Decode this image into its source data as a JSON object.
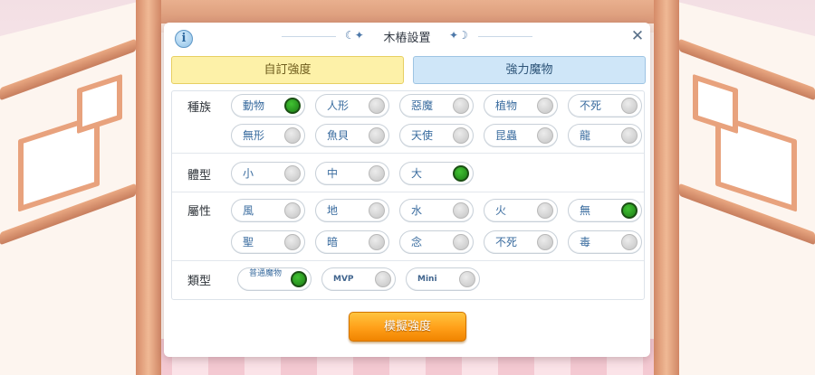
{
  "dialog": {
    "title": "木樁設置",
    "info_icon": "info-icon",
    "close_icon": "close-icon",
    "tabs": [
      {
        "label": "自訂強度",
        "active": true
      },
      {
        "label": "強力魔物",
        "active": false
      }
    ],
    "sections": {
      "race": {
        "label": "種族",
        "options": [
          {
            "label": "動物",
            "on": true
          },
          {
            "label": "人形",
            "on": false
          },
          {
            "label": "惡魔",
            "on": false
          },
          {
            "label": "植物",
            "on": false
          },
          {
            "label": "不死",
            "on": false
          },
          {
            "label": "無形",
            "on": false
          },
          {
            "label": "魚貝",
            "on": false
          },
          {
            "label": "天使",
            "on": false
          },
          {
            "label": "昆蟲",
            "on": false
          },
          {
            "label": "龍",
            "on": false
          }
        ]
      },
      "size": {
        "label": "體型",
        "options": [
          {
            "label": "小",
            "on": false
          },
          {
            "label": "中",
            "on": false
          },
          {
            "label": "大",
            "on": true
          }
        ]
      },
      "element": {
        "label": "屬性",
        "options": [
          {
            "label": "風",
            "on": false
          },
          {
            "label": "地",
            "on": false
          },
          {
            "label": "水",
            "on": false
          },
          {
            "label": "火",
            "on": false
          },
          {
            "label": "無",
            "on": true
          },
          {
            "label": "聖",
            "on": false
          },
          {
            "label": "暗",
            "on": false
          },
          {
            "label": "念",
            "on": false
          },
          {
            "label": "不死",
            "on": false
          },
          {
            "label": "毒",
            "on": false
          }
        ]
      },
      "type": {
        "label": "類型",
        "options": [
          {
            "label": "普通魔物",
            "on": true
          },
          {
            "label": "MVP",
            "on": false
          },
          {
            "label": "Mini",
            "on": false
          }
        ]
      }
    },
    "simulate_label": "模擬強度"
  },
  "colors": {
    "toggle_on": "#2a9d20",
    "toggle_off": "#cfcfcf",
    "accent_orange": "#ff9f18",
    "tab_yellow": "#fdf1a8",
    "tab_blue": "#cfe6f8"
  }
}
